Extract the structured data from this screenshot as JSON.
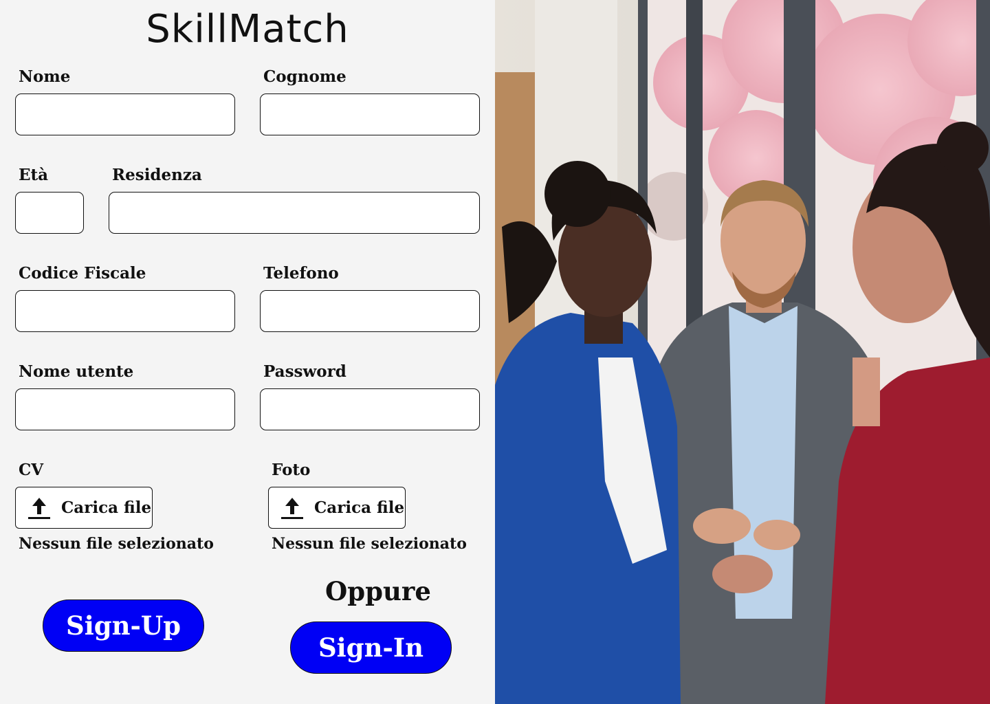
{
  "app": {
    "title": "SkillMatch"
  },
  "form": {
    "nome": {
      "label": "Nome",
      "value": ""
    },
    "cognome": {
      "label": "Cognome",
      "value": ""
    },
    "eta": {
      "label": "Età",
      "value": ""
    },
    "residenza": {
      "label": "Residenza",
      "value": ""
    },
    "codice_fiscale": {
      "label": "Codice Fiscale",
      "value": ""
    },
    "telefono": {
      "label": "Telefono",
      "value": ""
    },
    "nome_utente": {
      "label": "Nome utente",
      "value": ""
    },
    "password": {
      "label": "Password",
      "value": ""
    },
    "cv": {
      "label": "CV",
      "button_label": "Carica file",
      "status": "Nessun file selezionato",
      "icon": "upload-icon"
    },
    "foto": {
      "label": "Foto",
      "button_label": "Carica file",
      "status": "Nessun file selezionato",
      "icon": "upload-icon"
    }
  },
  "actions": {
    "signup_label": "Sign-Up",
    "or_label": "Oppure",
    "signin_label": "Sign-In"
  },
  "colors": {
    "primary_button": "#0000f5",
    "panel_background": "#f4f4f4",
    "input_background": "#ffffff"
  }
}
